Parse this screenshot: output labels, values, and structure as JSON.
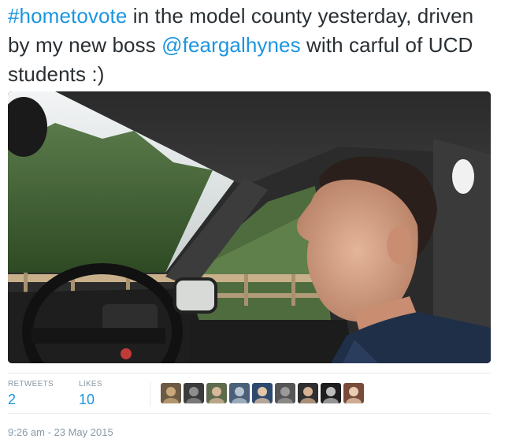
{
  "tweet": {
    "hashtag": "#hometovote",
    "text_part1": " in the model county yesterday, driven by my new boss ",
    "mention": "@feargalhynes",
    "text_part2": " with carful of UCD students :)"
  },
  "media": {
    "description_icon": "photo"
  },
  "stats": {
    "retweets_label": "RETWEETS",
    "retweets_count": "2",
    "likes_label": "LIKES",
    "likes_count": "10"
  },
  "likers": [
    {
      "name": "liker-avatar-1",
      "color_bg": "#6d5a44",
      "color_fg": "#c9a97a"
    },
    {
      "name": "liker-avatar-2",
      "color_bg": "#3b3b3b",
      "color_fg": "#8e8e8e"
    },
    {
      "name": "liker-avatar-3",
      "color_bg": "#5e6b4f",
      "color_fg": "#d8b89a"
    },
    {
      "name": "liker-avatar-4",
      "color_bg": "#4a5f7a",
      "color_fg": "#b8c4cf"
    },
    {
      "name": "liker-avatar-5",
      "color_bg": "#2d4a6e",
      "color_fg": "#e2c6a8"
    },
    {
      "name": "liker-avatar-6",
      "color_bg": "#555555",
      "color_fg": "#9a9a9a"
    },
    {
      "name": "liker-avatar-7",
      "color_bg": "#2f2f2f",
      "color_fg": "#d4b293"
    },
    {
      "name": "liker-avatar-8",
      "color_bg": "#1e1e1e",
      "color_fg": "#bdbdbd"
    },
    {
      "name": "liker-avatar-9",
      "color_bg": "#7a4a3a",
      "color_fg": "#e8cdb0"
    }
  ],
  "timestamp": "9:26 am - 23 May 2015",
  "colors": {
    "link": "#1b95e0",
    "muted": "#8899a6",
    "text": "#292f33"
  }
}
